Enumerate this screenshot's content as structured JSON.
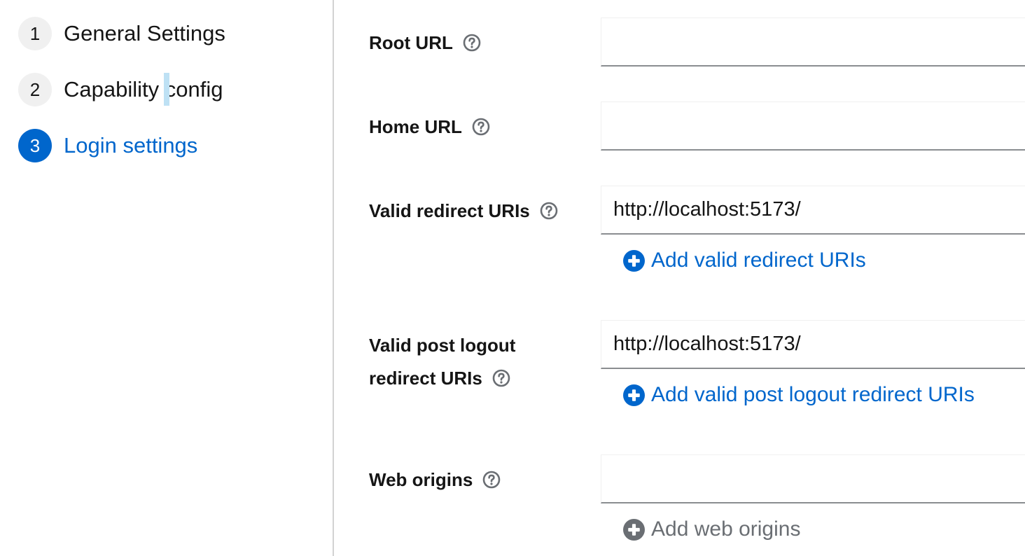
{
  "wizard": {
    "steps": [
      {
        "number": "1",
        "label": "General Settings"
      },
      {
        "number": "2",
        "label": "Capability config"
      },
      {
        "number": "3",
        "label": "Login settings"
      }
    ],
    "current_step": "3"
  },
  "form": {
    "root_url": {
      "label": "Root URL",
      "value": ""
    },
    "home_url": {
      "label": "Home URL",
      "value": ""
    },
    "valid_redirect_uris": {
      "label": "Valid redirect URIs",
      "value": "http://localhost:5173/",
      "add_label": "Add valid redirect URIs"
    },
    "valid_post_logout_redirect_uris": {
      "label_line1": "Valid post logout",
      "label_line2": "redirect URIs",
      "value": "http://localhost:5173/",
      "add_label": "Add valid post logout redirect URIs"
    },
    "web_origins": {
      "label": "Web origins",
      "value": "",
      "add_label": "Add web origins"
    }
  },
  "icons": {
    "help": "question-circle-icon",
    "add": "plus-circle-icon"
  },
  "colors": {
    "accent": "#0066cc",
    "text": "#151515",
    "disabled": "#6a6e73",
    "step_inactive_bg": "#f0f0f0",
    "border": "#8a8d90"
  }
}
